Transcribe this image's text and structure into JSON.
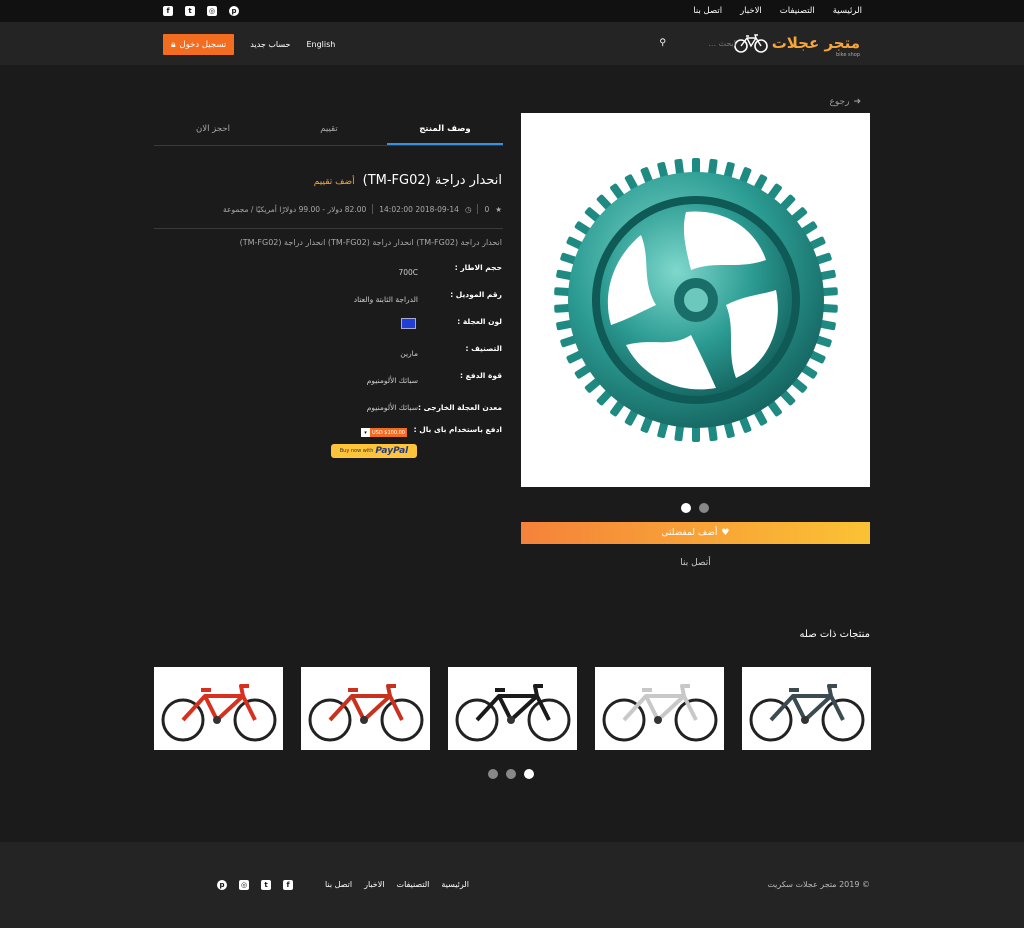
{
  "topbar": {
    "links": [
      "الرئيسية",
      "التصنيفات",
      "الاخبار",
      "اتصل بنا"
    ],
    "social": [
      "facebook-icon",
      "twitter-icon",
      "instagram-icon",
      "pinterest-icon"
    ]
  },
  "header": {
    "logo_text": "متجر عجلات",
    "logo_sub": "bike shop",
    "search_placeholder": "ابحث ...",
    "language": "English",
    "register": "حساب جديد",
    "login": "تسجيل دخول"
  },
  "back": "رجوع",
  "product": {
    "name": "انحدار دراجة (TM-FG02)",
    "rate_link": "أضف تقييم",
    "rating": "0",
    "date": "2018-09-14 14:02:00",
    "price": "82.00 دولار - 99.00 دولارًا أمريكيًا / مجموعة",
    "description": "انحدار دراجة (TM-FG02) انحدار دراجة (TM-FG02) انحدار دراجة (TM-FG02)",
    "attributes": [
      {
        "label": "حجم الاطار :",
        "value": "700C"
      },
      {
        "label": "رقم الموديل :",
        "value": "الدراجة الثابتة والعتاد"
      },
      {
        "label": "لون العجلة :",
        "value": ""
      },
      {
        "label": "التصنيف :",
        "value": "مارين"
      },
      {
        "label": "قوة الدفع :",
        "value": "سبائك الألومنيوم"
      },
      {
        "label": "معدن العجلة الخارجى :",
        "value": "سبائك الألومنيوم"
      },
      {
        "label": "ادفع باستخدام باى بال :",
        "value": ""
      }
    ],
    "paypal_price": "USD $100.00",
    "paypal_buy": "Buy now with",
    "paypal_brand": "PayPal",
    "wheel_color": "#1f3fd6"
  },
  "tabs": [
    "وصف المنتج",
    "تقييم",
    "احجز الان"
  ],
  "favorite_button": "أضف لمفضلتى",
  "contact_link": "أتصل بنا",
  "related_title": "منتجات ذات صله",
  "related_colors": [
    "#d8301f",
    "#c8311d",
    "#1a1a1a",
    "#c8c8c8",
    "#3c4a52",
    "#d8301f"
  ],
  "footer": {
    "copyright": "© 2019 متجر عجلات سكريت",
    "links": [
      "الرئيسية",
      "التصنيفات",
      "الاخبار",
      "اتصل بنا"
    ]
  }
}
